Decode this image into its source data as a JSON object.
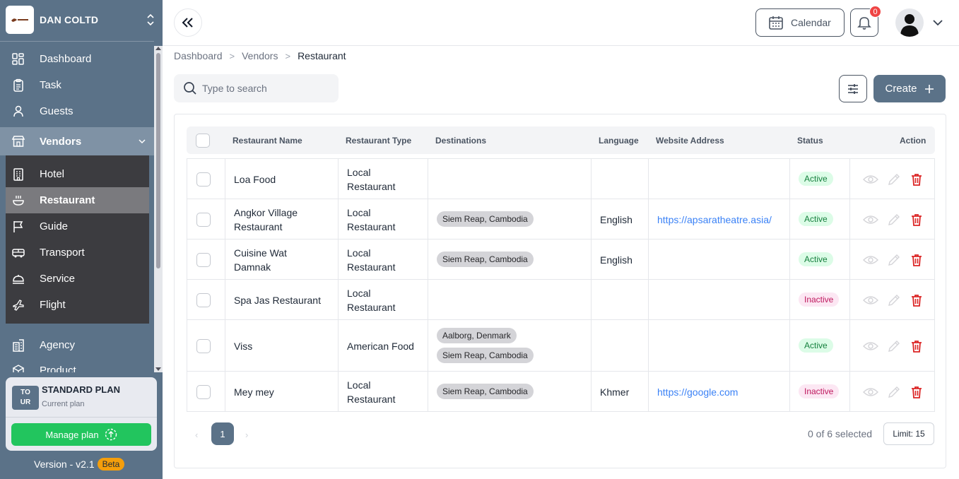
{
  "org": {
    "name": "DAN COLTD"
  },
  "nav": {
    "dashboard": "Dashboard",
    "task": "Task",
    "guests": "Guests",
    "vendors": "Vendors",
    "hotel": "Hotel",
    "restaurant": "Restaurant",
    "guide": "Guide",
    "transport": "Transport",
    "service": "Service",
    "flight": "Flight",
    "agency": "Agency",
    "product": "Product"
  },
  "plan": {
    "logo_line1": "TO",
    "logo_line2": "UR",
    "title": "STANDARD PLAN",
    "subtitle": "Current plan",
    "manage_label": "Manage plan"
  },
  "version": {
    "label": "Version - v2.1",
    "badge": "Beta"
  },
  "topbar": {
    "calendar_label": "Calendar",
    "notification_count": "0"
  },
  "breadcrumb": [
    "Dashboard",
    "Vendors",
    "Restaurant"
  ],
  "search": {
    "placeholder": "Type to search",
    "value": ""
  },
  "toolbar": {
    "create_label": "Create"
  },
  "table": {
    "columns": [
      "Restaurant Name",
      "Restaurant Type",
      "Destinations",
      "Language",
      "Website Address",
      "Status",
      "Action"
    ],
    "rows": [
      {
        "name": [
          "Loa Food"
        ],
        "type": [
          "Local",
          "Restaurant"
        ],
        "destinations": [],
        "language": "",
        "website": "",
        "status": "Active"
      },
      {
        "name": [
          "Angkor Village",
          "Restaurant"
        ],
        "type": [
          "Local",
          "Restaurant"
        ],
        "destinations": [
          "Siem Reap, Cambodia"
        ],
        "language": "English",
        "website": "https://apsaratheatre.asia/",
        "status": "Active"
      },
      {
        "name": [
          "Cuisine Wat",
          "Damnak"
        ],
        "type": [
          "Local",
          "Restaurant"
        ],
        "destinations": [
          "Siem Reap, Cambodia"
        ],
        "language": "English",
        "website": "",
        "status": "Active"
      },
      {
        "name": [
          "Spa Jas Restaurant"
        ],
        "type": [
          "Local",
          "Restaurant"
        ],
        "destinations": [],
        "language": "",
        "website": "",
        "status": "Inactive"
      },
      {
        "name": [
          "Viss"
        ],
        "type": [
          "American Food"
        ],
        "destinations": [
          "Aalborg, Denmark",
          "Siem Reap, Cambodia"
        ],
        "language": "",
        "website": "",
        "status": "Active"
      },
      {
        "name": [
          "Mey mey"
        ],
        "type": [
          "Local",
          "Restaurant"
        ],
        "destinations": [
          "Siem Reap, Cambodia"
        ],
        "language": "Khmer",
        "website": "https://google.com",
        "status": "Inactive"
      }
    ]
  },
  "pagination": {
    "current_page": "1",
    "prev_symbol": "‹",
    "next_symbol": "›",
    "selected_text": "0 of 6 selected",
    "limit_label": "Limit: 15"
  },
  "colors": {
    "sidebar": "#5b7288",
    "primary": "#5b7288",
    "active_green": "#22c55e",
    "delete_red": "#dc2626",
    "badge_red": "#ef4444"
  }
}
